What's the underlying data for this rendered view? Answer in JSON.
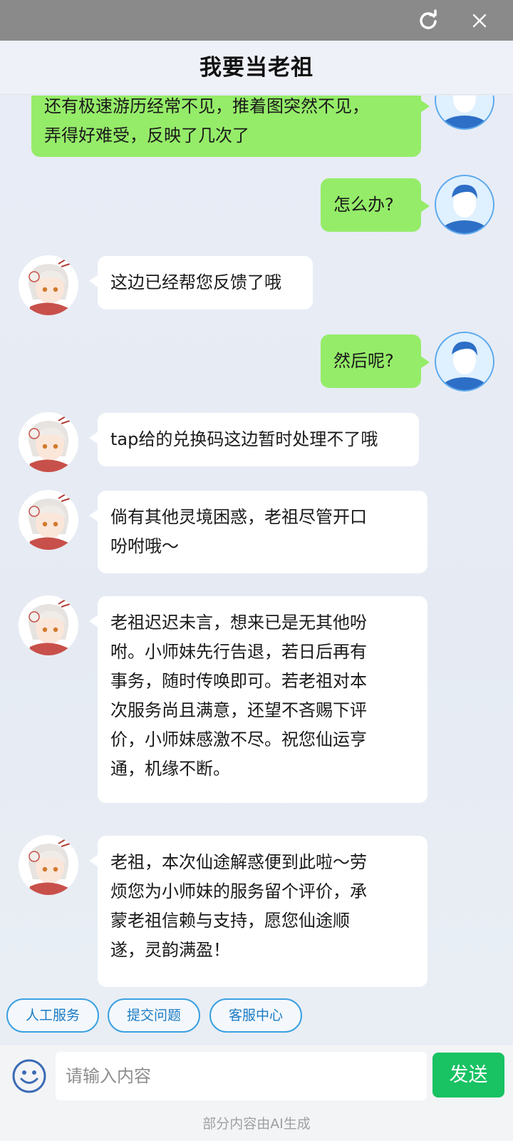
{
  "header": {
    "title": "我要当老祖"
  },
  "topbar": {
    "refresh_icon": "refresh-icon",
    "close_icon": "close-icon"
  },
  "messages": [
    {
      "from": "user",
      "lines": [
        "还有极速游历经常不见，推着图突然不见，",
        "弄得好难受，反映了几次了"
      ]
    },
    {
      "from": "user",
      "lines": [
        "怎么办?"
      ]
    },
    {
      "from": "bot",
      "lines": [
        "这边已经帮您反馈了哦"
      ]
    },
    {
      "from": "user",
      "lines": [
        "然后呢?"
      ]
    },
    {
      "from": "bot",
      "lines": [
        "tap给的兑换码这边暂时处理不了哦"
      ]
    },
    {
      "from": "bot",
      "lines": [
        "倘有其他灵境困惑，老祖尽管开口",
        "吩咐哦～"
      ]
    },
    {
      "from": "bot",
      "lines": [
        "老祖迟迟未言，想来已是无其他吩",
        "咐。小师妹先行告退，若日后再有",
        "事务，随时传唤即可。若老祖对本",
        "次服务尚且满意，还望不吝赐下评",
        "价，小师妹感激不尽。祝您仙运亨",
        "通，机缘不断。"
      ]
    },
    {
      "from": "bot",
      "lines": [
        "老祖，本次仙途解惑便到此啦～劳",
        "烦您为小师妹的服务留个评价，承",
        "蒙老祖信赖与支持，愿您仙途顺",
        "遂，灵韵满盈！"
      ]
    }
  ],
  "quick_actions": [
    "人工服务",
    "提交问题",
    "客服中心"
  ],
  "input": {
    "placeholder": "请输入内容",
    "value": ""
  },
  "send_label": "发送",
  "footer_note": "部分内容由AI生成",
  "colors": {
    "user_bubble": "#95ec69",
    "bot_bubble": "#ffffff",
    "send_button": "#19c263",
    "quick_border": "#3aa0e0"
  }
}
